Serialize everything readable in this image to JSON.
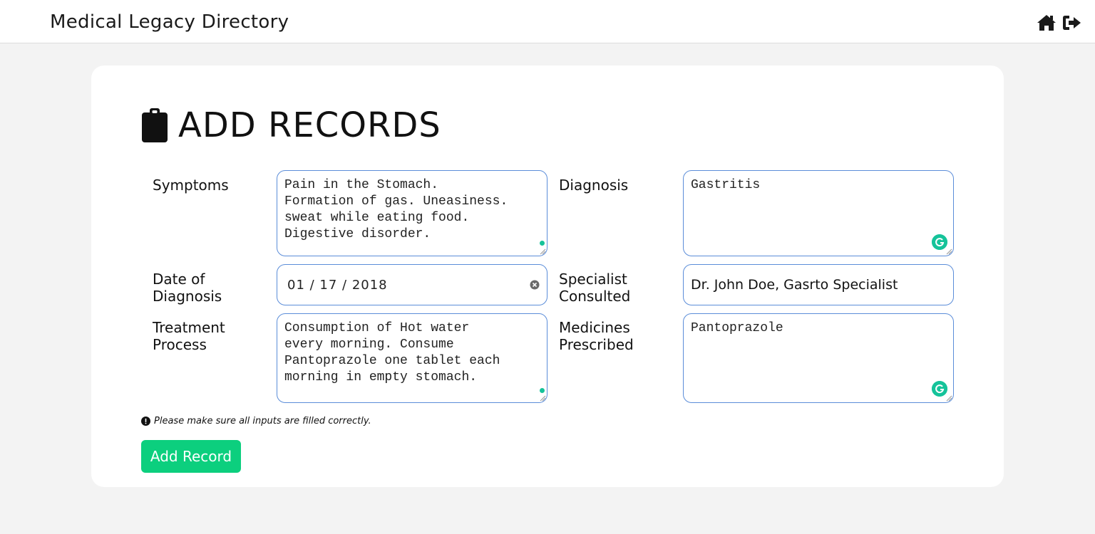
{
  "header": {
    "title": "Medical Legacy Directory",
    "icons": [
      "home-icon",
      "sign-out-icon"
    ]
  },
  "form": {
    "title": "ADD RECORDS",
    "title_icon": "clipboard-icon",
    "fields": {
      "symptoms": {
        "label": "Symptoms",
        "value": "Pain in the Stomach.\nFormation of gas. Uneasiness.\nsweat while eating food.\nDigestive disorder."
      },
      "diagnosis": {
        "label": "Diagnosis",
        "value": "Gastritis"
      },
      "date_of_diagnosis": {
        "label": "Date of Diagnosis",
        "value": "01 / 17 / 2018"
      },
      "specialist_consulted": {
        "label": "Specialist Consulted",
        "value": "Dr. John Doe, Gasrto Specialist"
      },
      "treatment_process": {
        "label": "Treatment Process",
        "value": "Consumption of Hot water\nevery morning. Consume\nPantoprazole one tablet each\nmorning in empty stomach."
      },
      "medicines_prescribed": {
        "label": "Medicines Prescribed",
        "value": "Pantoprazole"
      }
    },
    "note": "Please make sure all inputs are filled correctly.",
    "submit_label": "Add Record"
  },
  "colors": {
    "accent": "#0ccf7e",
    "field_border": "#5b8dd9",
    "grammarly": "#15c39a",
    "background": "#f3f3f3"
  }
}
